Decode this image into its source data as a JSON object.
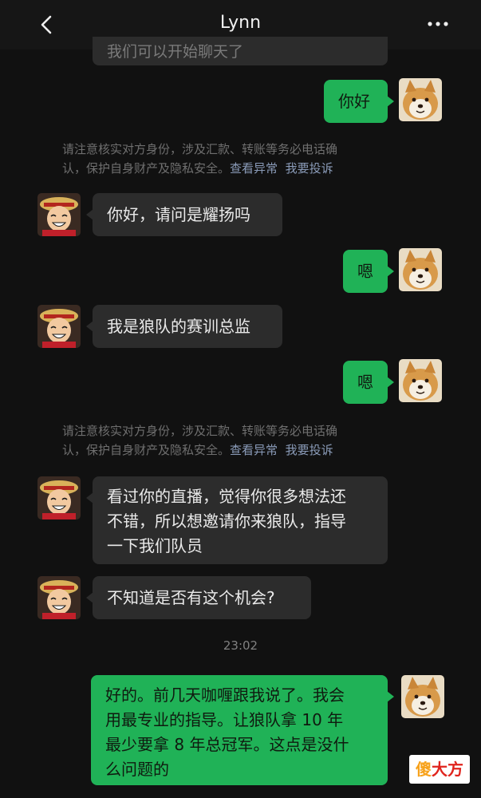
{
  "header": {
    "title": "Lynn"
  },
  "icons": {
    "back": "chevron-left-icon",
    "more": "more-horizontal-icon",
    "self_avatar": "shiba-dog-avatar",
    "contact_avatar": "cartoon-pirate-avatar"
  },
  "colors": {
    "background": "#111111",
    "incoming_bubble": "#2c2c2c",
    "outgoing_bubble": "#20b257",
    "notice_text": "#6f6f6f",
    "notice_link": "#8a9bb8"
  },
  "messages": {
    "partial_top": "我们可以开始聊天了",
    "m1": "你好",
    "m2": "你好，请问是耀扬吗",
    "m3": "嗯",
    "m4": "我是狼队的赛训总监",
    "m5": "嗯",
    "m6_line1": "看过你的直播，觉得你很多想法还",
    "m6_line2": "不错，所以想邀请你来狼队，指导",
    "m6_line3": "一下我们队员",
    "m7": "不知道是否有这个机会?",
    "m8_line1": "好的。前几天咖喱跟我说了。我会",
    "m8_line2": "用最专业的指导。让狼队拿 10 年",
    "m8_line3": "最少要拿 8 年总冠军。这点是没什",
    "m8_line4": "么问题的"
  },
  "notices": {
    "line1": "请注意核实对方身份，涉及汇款、转账等务必电话确",
    "line2_prefix": "认，保护自身财产及隐私安全。",
    "view_anomaly": "查看异常",
    "report": "我要投诉"
  },
  "timestamp": "23:02",
  "watermark": {
    "char1": "傻",
    "char2": "大",
    "char3": "方"
  }
}
